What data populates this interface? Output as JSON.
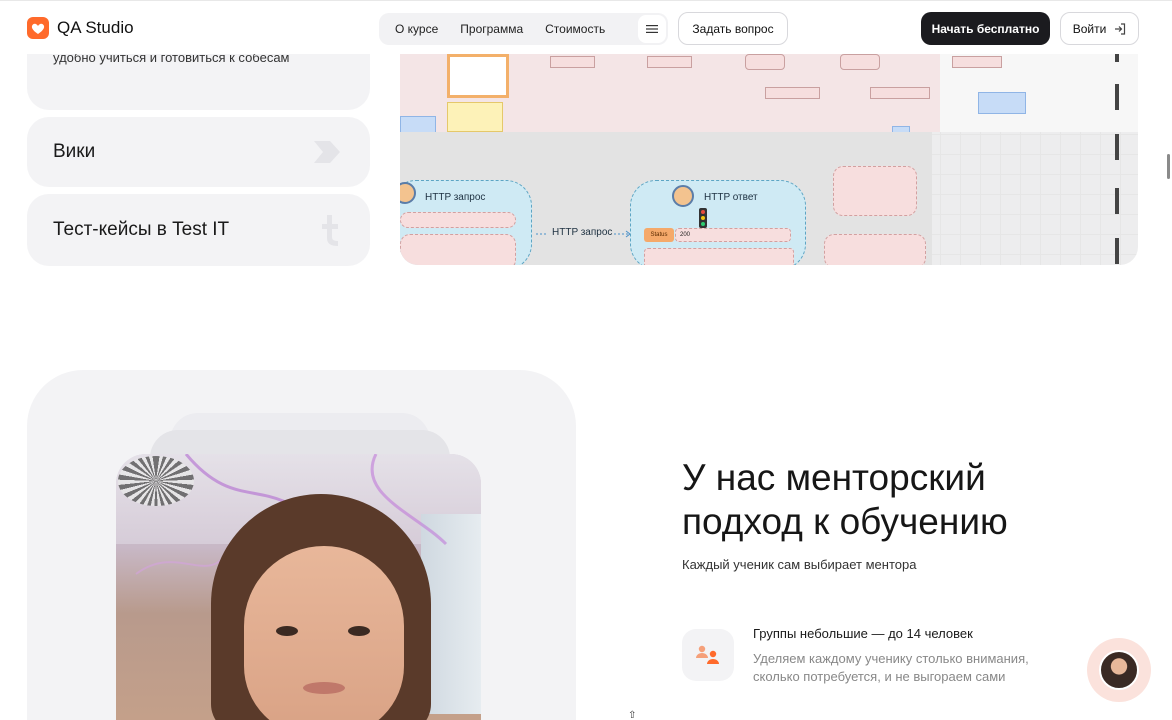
{
  "header": {
    "logo_text": "QA Studio",
    "nav": [
      "О курсе",
      "Программа",
      "Стоимость"
    ],
    "ask_button": "Задать вопрос",
    "start_button": "Начать бесплатно",
    "login_button": "Войти"
  },
  "cards": {
    "first_sub": "удобно учиться и готовиться к собесам",
    "wiki": "Вики",
    "testcases": "Тест-кейсы в Test IT"
  },
  "diagram": {
    "http_request_label": "HTTP запрос",
    "http_response_label": "HTTP ответ",
    "arrow_label": "HTTP запрос",
    "status_label": "Status",
    "status_value": "200"
  },
  "mentor": {
    "title": "У нас менторский подход к обучению",
    "subtitle": "Каждый ученик сам выбирает ментора",
    "feature_title": "Группы небольшие — до 14 человек",
    "feature_text": "Уделяем каждому ученику столько внимания, сколько потребуется, и не выгораем сами"
  },
  "colors": {
    "brand": "#ff6a2b",
    "dark_button": "#1b1b1f",
    "card_bg": "#f3f3f5"
  }
}
